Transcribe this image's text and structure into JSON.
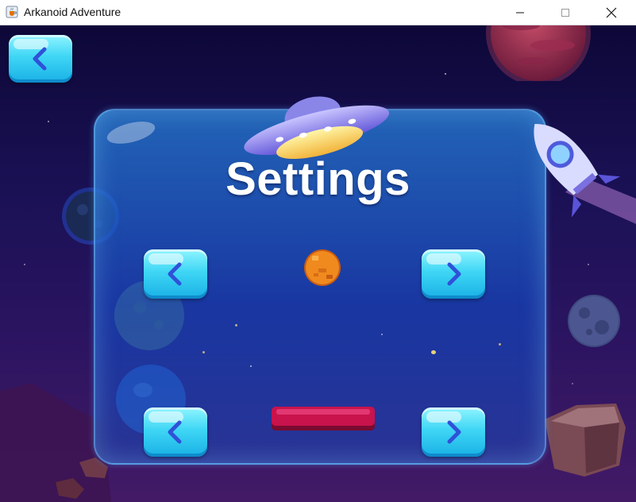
{
  "window": {
    "title": "Arkanoid Adventure",
    "app_icon": "java-coffee-cup-icon",
    "controls": [
      "minimize-icon",
      "maximize-icon",
      "close-icon"
    ]
  },
  "screen": {
    "title": "Settings",
    "back_button_icon": "chevron-left-icon",
    "ball_selector": {
      "prev_icon": "chevron-left-icon",
      "next_icon": "chevron-right-icon",
      "preview": "orange-pixel-ball"
    },
    "paddle_selector": {
      "prev_icon": "chevron-left-icon",
      "next_icon": "chevron-right-icon",
      "preview": "red-paddle"
    }
  },
  "colors": {
    "background_top": "#0d0838",
    "background_bottom": "#431a66",
    "button_cyan": "#3fd6f5",
    "arrow_blue": "#2f52d8",
    "ball_orange": "#f08a1e",
    "paddle_red": "#c8134c"
  },
  "decorations": [
    "ufo",
    "rocket",
    "red-planet",
    "blue-planet",
    "gray-moon",
    "green-planet",
    "rocks"
  ]
}
